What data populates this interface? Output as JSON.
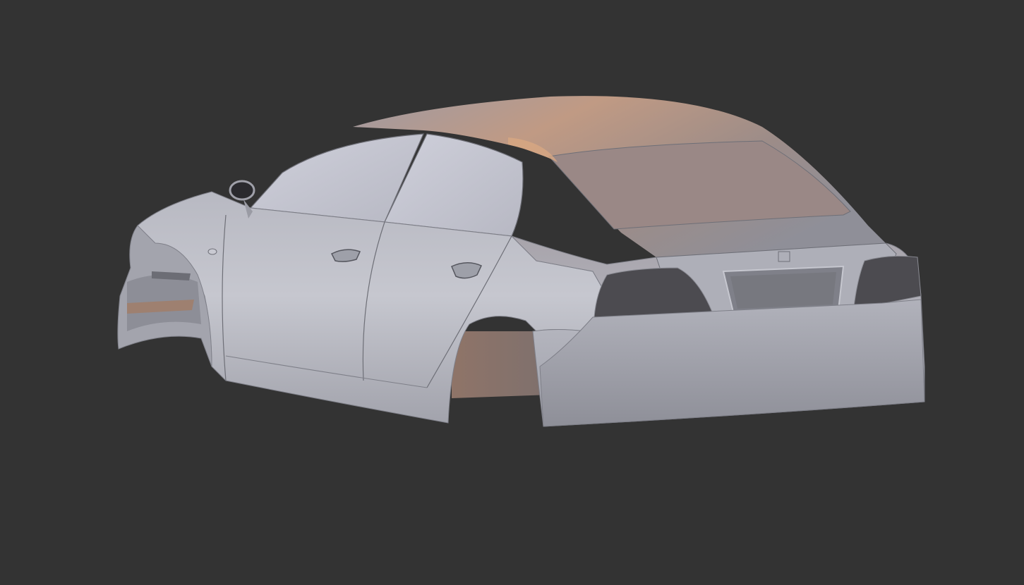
{
  "viewport": {
    "background_color": "#333333",
    "model": {
      "subject": "car-body-shell",
      "colors": {
        "body_light": "#c7c8d0",
        "body_mid": "#a9aab3",
        "body_dark": "#7e7f88",
        "roof_warm": "#9a8a86",
        "roof_highlight": "#c39a80",
        "interior_warm": "#8e7468",
        "light_recess": "#4a4a4e",
        "edge_line": "#6e6f77"
      }
    }
  }
}
